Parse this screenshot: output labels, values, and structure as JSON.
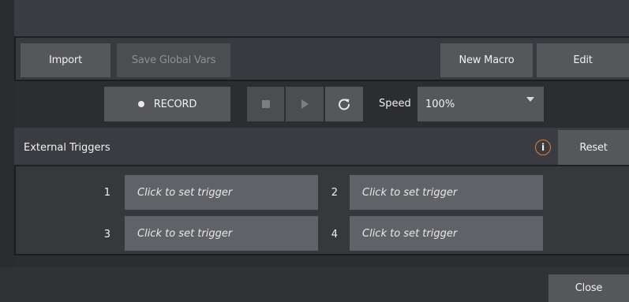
{
  "toolbar": {
    "import_label": "Import",
    "save_global_vars_label": "Save Global Vars",
    "new_macro_label": "New Macro",
    "edit_label": "Edit"
  },
  "recorder": {
    "record_label": "RECORD",
    "speed_label": "Speed",
    "speed_value": "100%"
  },
  "external_triggers": {
    "title": "External Triggers",
    "reset_label": "Reset",
    "triggers": [
      {
        "number": "1",
        "label": "Click to set trigger"
      },
      {
        "number": "2",
        "label": "Click to set trigger"
      },
      {
        "number": "3",
        "label": "Click to set trigger"
      },
      {
        "number": "4",
        "label": "Click to set trigger"
      }
    ]
  },
  "footer": {
    "close_label": "Close"
  },
  "colors": {
    "info_accent": "#e07a3a"
  }
}
